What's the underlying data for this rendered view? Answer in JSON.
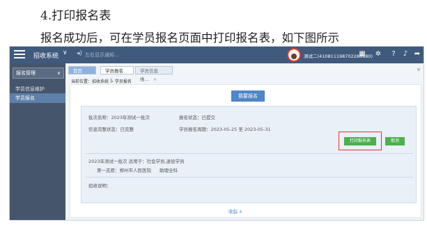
{
  "doc": {
    "heading": "4.打印报名表",
    "paragraph": "报名成功后，可在学员报名页面中打印报名表，如下图所示"
  },
  "topbar": {
    "system_title": "招收系统",
    "chevron": "∨",
    "notify_text": "左右显示通知...",
    "user": "测试二(410811198702280180)",
    "icons": [
      "menu-icon",
      "speaker-icon",
      "calendar-icon",
      "gear-icon",
      "help-icon",
      "bell-icon",
      "share-icon"
    ]
  },
  "sidebar": {
    "group": "报名管理",
    "items": [
      "学员信息维护",
      "学员报名"
    ],
    "active_index": 1
  },
  "tabs": [
    {
      "label": "首页"
    },
    {
      "label": "学员报名",
      "close": "×"
    },
    {
      "label": "学员信息维...",
      "close": "×"
    }
  ],
  "tabs_close_all": "×",
  "breadcrumb": "当前位置：招收系统 > 学员报名",
  "main": {
    "register_button": "我要报名",
    "batch_label": "批次名称：2023年测试一批次",
    "status_label": "报名状态：已提交",
    "info_label": "信息完整状态：已完整",
    "period_label": "学员报名周期：2023-05-25 至 2023-05-31",
    "print_button": "打印报名表",
    "cancel_button": "取消",
    "batch_desc": "2023年测试一批次 适用于：社会学员,退役学员",
    "choice": "第一志愿：郑州市人民医院",
    "major": "助理全科",
    "remark_label": "招收说明：",
    "collapse": "收起 ∧"
  },
  "colors": {
    "topbar": "#3f5a7c",
    "sidebar": "#45556b",
    "accent": "#4f86c6",
    "green": "#4caf50",
    "highlight": "#e03030"
  }
}
